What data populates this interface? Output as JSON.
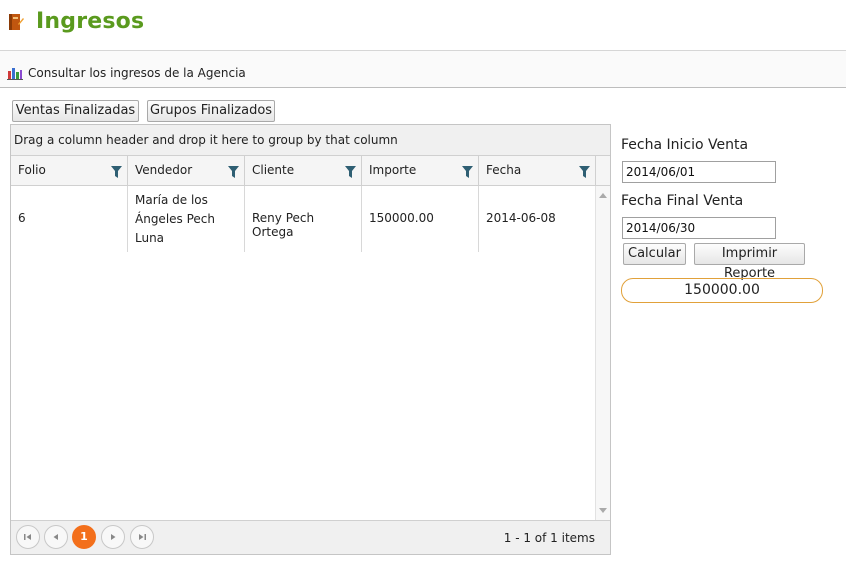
{
  "app": {
    "title": "Ingresos",
    "subtitle": "Consultar los ingresos de la Agencia"
  },
  "tabs": {
    "ventas_label": "Ventas Finalizadas",
    "grupos_label": "Grupos Finalizados"
  },
  "grid": {
    "group_hint": "Drag a column header and drop it here to group by that column",
    "columns": [
      "Folio",
      "Vendedor",
      "Cliente",
      "Importe",
      "Fecha"
    ],
    "rows": [
      {
        "folio": "6",
        "vendedor_lines": [
          "María de los",
          "Ángeles Pech",
          "Luna"
        ],
        "cliente": "Reny Pech Ortega",
        "importe": "150000.00",
        "fecha": "2014-06-08"
      }
    ],
    "pager": {
      "current_page": "1",
      "info": "1 - 1 of 1 items"
    }
  },
  "filters": {
    "start_label": "Fecha Inicio Venta",
    "start_value": "2014/06/01",
    "end_label": "Fecha Final Venta",
    "end_value": "2014/06/30",
    "calc_label": "Calcular",
    "print_label": "Imprimir Reporte",
    "total": "150000.00"
  },
  "colors": {
    "title_green": "#5a9a1e",
    "pager_orange": "#f36f1b",
    "total_border": "#e1a13a",
    "filter_icon": "#2f5f73"
  }
}
